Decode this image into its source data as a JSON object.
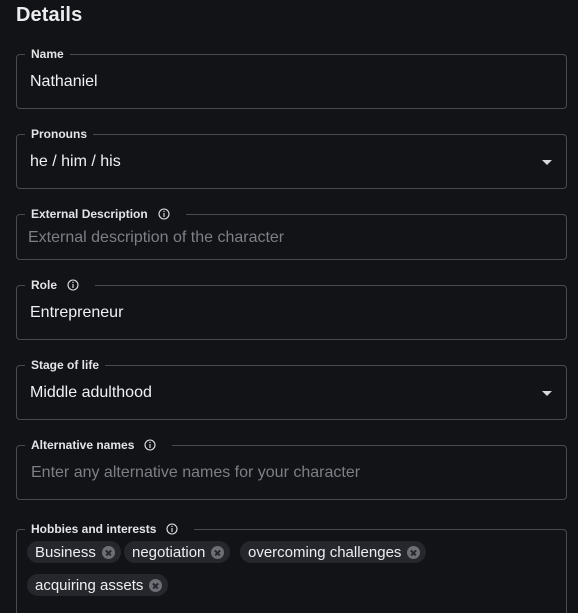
{
  "section": {
    "title": "Details"
  },
  "fields": {
    "name": {
      "label": "Name",
      "value": "Nathaniel"
    },
    "pronouns": {
      "label": "Pronouns",
      "value": "he / him / his"
    },
    "external_description": {
      "label": "External Description",
      "placeholder": "External description of the character"
    },
    "role": {
      "label": "Role",
      "value": "Entrepreneur"
    },
    "stage_of_life": {
      "label": "Stage of life",
      "value": "Middle adulthood"
    },
    "alternative_names": {
      "label": "Alternative names",
      "placeholder": "Enter any alternative names for your character"
    },
    "hobbies": {
      "label": "Hobbies and interests",
      "chips": [
        "Business",
        "negotiation",
        "overcoming challenges",
        "acquiring assets"
      ]
    }
  },
  "icons": {
    "info": "info-circle-icon",
    "dropdown": "caret-down-icon",
    "remove_chip": "close-circle-icon"
  },
  "colors": {
    "background": "#121317",
    "border": "#4a4b52",
    "chip_background": "#26272d",
    "placeholder_text": "#7e7f86"
  }
}
